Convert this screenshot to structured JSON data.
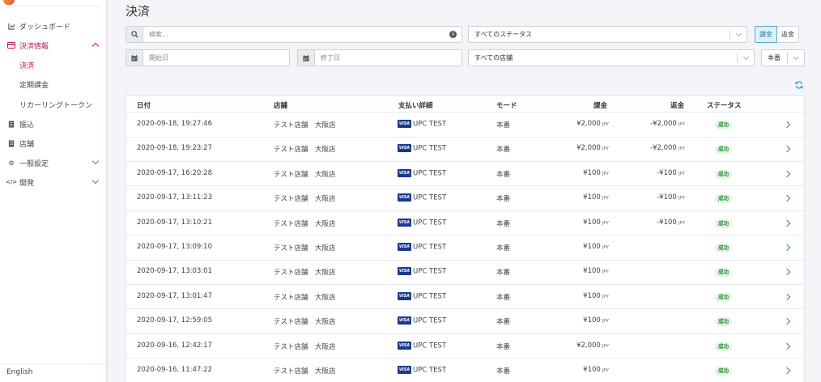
{
  "sidebar": {
    "items": [
      {
        "label": "ダッシュボード",
        "icon": "chart-icon"
      },
      {
        "label": "決済情報",
        "icon": "card-icon"
      },
      {
        "label": "決済"
      },
      {
        "label": "定期課金"
      },
      {
        "label": "リカーリングトークン"
      },
      {
        "label": "振込",
        "icon": "document-icon"
      },
      {
        "label": "店舗",
        "icon": "building-icon"
      },
      {
        "label": "一般設定",
        "icon": "gear-icon"
      },
      {
        "label": "開発",
        "icon": "code-icon"
      }
    ],
    "language": "English"
  },
  "colors": {
    "accent": "#c2185b",
    "success_bg": "#e4f5e6",
    "link": "#2a82b8"
  },
  "page": {
    "title": "決済"
  },
  "filters": {
    "search_placeholder": "検索...",
    "status_select": "すべてのステータス",
    "store_select": "すべての店舗",
    "start_date_placeholder": "開始日",
    "end_date_placeholder": "終了日",
    "type_toggle": {
      "charge": "課金",
      "refund": "返金"
    },
    "mode_select": "本番"
  },
  "table": {
    "columns": [
      "日付",
      "店舗",
      "支払い詳細",
      "モード",
      "課金",
      "返金",
      "ステータス"
    ],
    "currency": "JPY",
    "rows": [
      {
        "date": "2020-09-18, 19:27:46",
        "store": "テスト店舗　大阪店",
        "card": "VISA",
        "detail": "UPC TEST",
        "mode": "本番",
        "charge": "¥2,000",
        "refund": "-¥2,000",
        "status": "成功"
      },
      {
        "date": "2020-09-18, 19:23:27",
        "store": "テスト店舗　大阪店",
        "card": "VISA",
        "detail": "UPC TEST",
        "mode": "本番",
        "charge": "¥2,000",
        "refund": "-¥2,000",
        "status": "成功"
      },
      {
        "date": "2020-09-17, 16:20:28",
        "store": "テスト店舗　大阪店",
        "card": "VISA",
        "detail": "UPC TEST",
        "mode": "本番",
        "charge": "¥100",
        "refund": "-¥100",
        "status": "成功"
      },
      {
        "date": "2020-09-17, 13:11:23",
        "store": "テスト店舗　大阪店",
        "card": "VISA",
        "detail": "UPC TEST",
        "mode": "本番",
        "charge": "¥100",
        "refund": "-¥100",
        "status": "成功"
      },
      {
        "date": "2020-09-17, 13:10:21",
        "store": "テスト店舗　大阪店",
        "card": "VISA",
        "detail": "UPC TEST",
        "mode": "本番",
        "charge": "¥100",
        "refund": "-¥100",
        "status": "成功"
      },
      {
        "date": "2020-09-17, 13:09:10",
        "store": "テスト店舗　大阪店",
        "card": "VISA",
        "detail": "UPC TEST",
        "mode": "本番",
        "charge": "¥100",
        "refund": "",
        "status": "成功"
      },
      {
        "date": "2020-09-17, 13:03:01",
        "store": "テスト店舗　大阪店",
        "card": "VISA",
        "detail": "UPC TEST",
        "mode": "本番",
        "charge": "¥100",
        "refund": "",
        "status": "成功"
      },
      {
        "date": "2020-09-17, 13:01:47",
        "store": "テスト店舗　大阪店",
        "card": "VISA",
        "detail": "UPC TEST",
        "mode": "本番",
        "charge": "¥100",
        "refund": "",
        "status": "成功"
      },
      {
        "date": "2020-09-17, 12:59:05",
        "store": "テスト店舗　大阪店",
        "card": "VISA",
        "detail": "UPC TEST",
        "mode": "本番",
        "charge": "¥100",
        "refund": "",
        "status": "成功"
      },
      {
        "date": "2020-09-16, 12:42:17",
        "store": "テスト店舗　大阪店",
        "card": "VISA",
        "detail": "UPC TEST",
        "mode": "本番",
        "charge": "¥2,000",
        "refund": "",
        "status": "成功"
      },
      {
        "date": "2020-09-16, 11:47:22",
        "store": "テスト店舗　大阪店",
        "card": "VISA",
        "detail": "UPC TEST",
        "mode": "本番",
        "charge": "¥100",
        "refund": "",
        "status": "成功"
      }
    ]
  }
}
